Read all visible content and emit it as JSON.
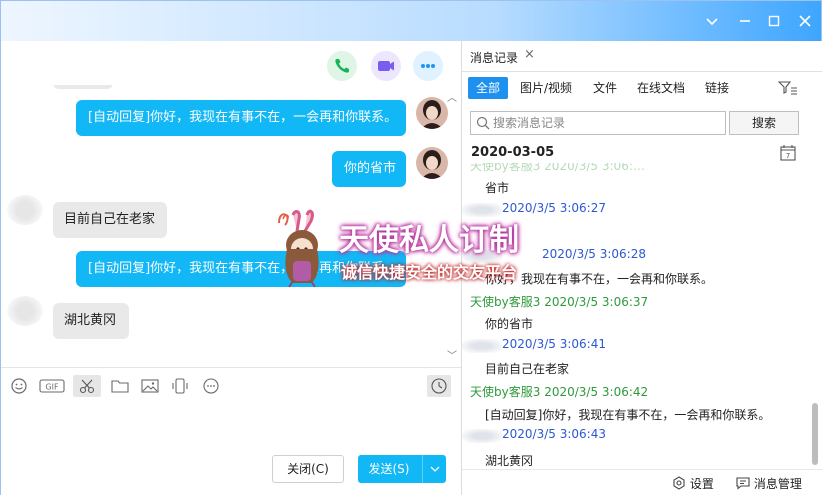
{
  "window": {
    "controls": [
      "chevron-down-icon",
      "minimize-icon",
      "maximize-icon",
      "close-icon"
    ]
  },
  "chat": {
    "messages": [
      {
        "dir": "out",
        "text": "[自动回复]你好，我现在有事不在，一会再和你联系。"
      },
      {
        "dir": "out",
        "text": "你的省市"
      },
      {
        "dir": "in",
        "text": "目前自己在老家"
      },
      {
        "dir": "out",
        "text": "[自动回复]你好，我现在有事不在，一会再和你联系。"
      },
      {
        "dir": "in",
        "text": "湖北黄冈"
      }
    ],
    "close_label": "关闭(C)",
    "send_label": "发送(S)"
  },
  "watermark": {
    "title": "天使私人订制",
    "subtitle": "诚信快捷安全的交友平台"
  },
  "history": {
    "tab_label": "消息记录",
    "filters": [
      "全部",
      "图片/视频",
      "文件",
      "在线文档",
      "链接"
    ],
    "search_placeholder": "搜索消息记录",
    "search_button": "搜索",
    "date": "2020-03-05",
    "entries": [
      {
        "sender": "",
        "time": "",
        "text": "省市"
      },
      {
        "sender": "",
        "time": "2020/3/5 3:06:27",
        "text": ""
      },
      {
        "sender": "",
        "time": "2020/3/5 3:06:28",
        "text": "你好，我现在有事不在，一会再和你联系。"
      },
      {
        "sender": "天使by客服3",
        "time": "2020/3/5 3:06:37",
        "text": "你的省市"
      },
      {
        "sender": "",
        "time": "2020/3/5 3:06:41",
        "text": "目前自己在老家"
      },
      {
        "sender": "天使by客服3",
        "time": "2020/3/5 3:06:42",
        "text": "[自动回复]你好，我现在有事不在，一会再和你联系。"
      },
      {
        "sender": "",
        "time": "2020/3/5 3:06:43",
        "text": "湖北黄冈"
      }
    ],
    "settings_label": "设置",
    "manage_label": "消息管理"
  }
}
